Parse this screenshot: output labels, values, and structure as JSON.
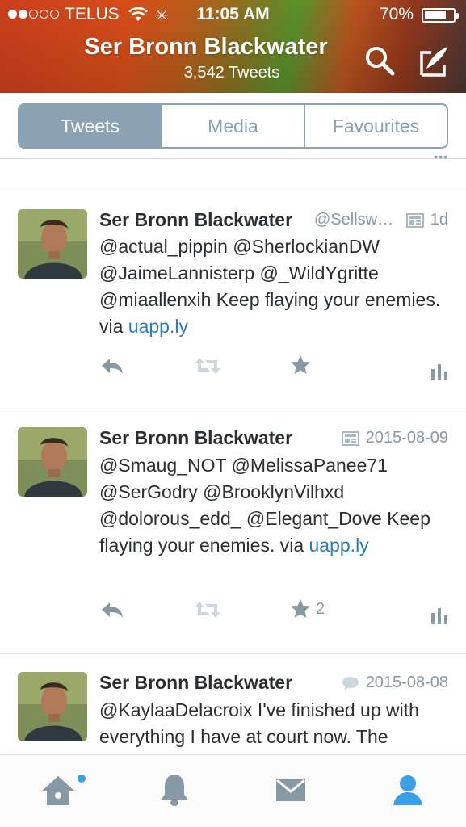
{
  "status_bar": {
    "carrier": "TELUS",
    "time": "11:05 AM",
    "battery": "70%",
    "signal_bars_filled": 2,
    "signal_bars_total": 5,
    "battery_level": 0.7
  },
  "header": {
    "title": "Ser Bronn Blackwater",
    "subtitle": "3,542 Tweets",
    "search_icon": "search-icon",
    "compose_icon": "compose-icon"
  },
  "segments": {
    "tweets": "Tweets",
    "media": "Media",
    "favourites": "Favourites",
    "selected": "Tweets"
  },
  "tweets": [
    {
      "name": "Ser Bronn Blackwater",
      "handle": "@Sellsw…",
      "time": "1d",
      "source_icon": "card-icon",
      "text": "@actual_pippin @SherlockianDW @JaimeLannisterp @_WildYgritte @miaallenxih Keep flaying your enemies. via ",
      "link": "uapp.ly",
      "favorites": ""
    },
    {
      "name": "Ser Bronn Blackwater",
      "handle": "",
      "time": "2015-08-09",
      "source_icon": "card-icon",
      "text": "@Smaug_NOT @MelissaPanee71 @SerGodry @BrooklynVilhxd @dolorous_edd_ @Elegant_Dove Keep flaying your enemies. via ",
      "link": "uapp.ly",
      "favorites": "2"
    },
    {
      "name": "Ser Bronn Blackwater",
      "handle": "",
      "time": "2015-08-08",
      "source_icon": "speech-bubble-icon",
      "text": "@KaylaaDelacroix I've finished up with everything I have at court now. The",
      "link": "",
      "favorites": ""
    }
  ],
  "tab_bar": {
    "items": [
      "home-icon",
      "notifications-icon",
      "messages-icon",
      "profile-icon"
    ],
    "active": "profile-icon",
    "home_has_notification": true
  },
  "colors": {
    "accent": "#8aa2b3",
    "link": "#2b7bb9",
    "active_tab": "#3aa0e8",
    "muted": "#8899a6"
  }
}
